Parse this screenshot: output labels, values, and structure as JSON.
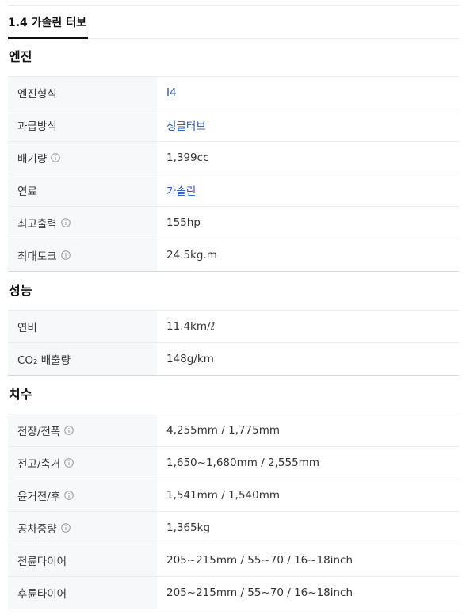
{
  "tab": {
    "label": "1.4 가솔린 터보"
  },
  "sections": [
    {
      "title": "엔진",
      "rows": [
        {
          "label": "엔진형식",
          "value": "I4"
        },
        {
          "label": "과급방식",
          "value": "싱글터보"
        },
        {
          "label": "배기량",
          "value": "1,399cc",
          "info_icon": "info-circle-icon"
        },
        {
          "label": "연료",
          "value": "가솔린"
        },
        {
          "label": "최고출력",
          "value": "155hp",
          "info_icon": "info-circle-icon"
        },
        {
          "label": "최대토크",
          "value": "24.5kg.m",
          "info_icon": "info-circle-icon"
        }
      ]
    },
    {
      "title": "성능",
      "rows": [
        {
          "label": "연비",
          "value": "11.4km/ℓ"
        },
        {
          "label": "CO₂ 배출량",
          "value": "148g/km"
        }
      ]
    },
    {
      "title": "치수",
      "rows": [
        {
          "label": "전장/전폭",
          "value": "4,255mm / 1,775mm",
          "info_icon": "info-circle-icon"
        },
        {
          "label": "전고/축거",
          "value": "1,650~1,680mm / 2,555mm",
          "info_icon": "info-circle-icon"
        },
        {
          "label": "윤거전/후",
          "value": "1,541mm / 1,540mm",
          "info_icon": "info-circle-icon"
        },
        {
          "label": "공차중량",
          "value": "1,365kg",
          "info_icon": "info-circle-icon"
        },
        {
          "label": "전륜타이어",
          "value": "205~215mm / 55~70 / 16~18inch"
        },
        {
          "label": "후륜타이어",
          "value": "205~215mm / 55~70 / 16~18inch"
        }
      ]
    }
  ],
  "colors": {
    "link": "#2650b5",
    "label_bg": "#f7f8fa",
    "border": "#ececec"
  }
}
